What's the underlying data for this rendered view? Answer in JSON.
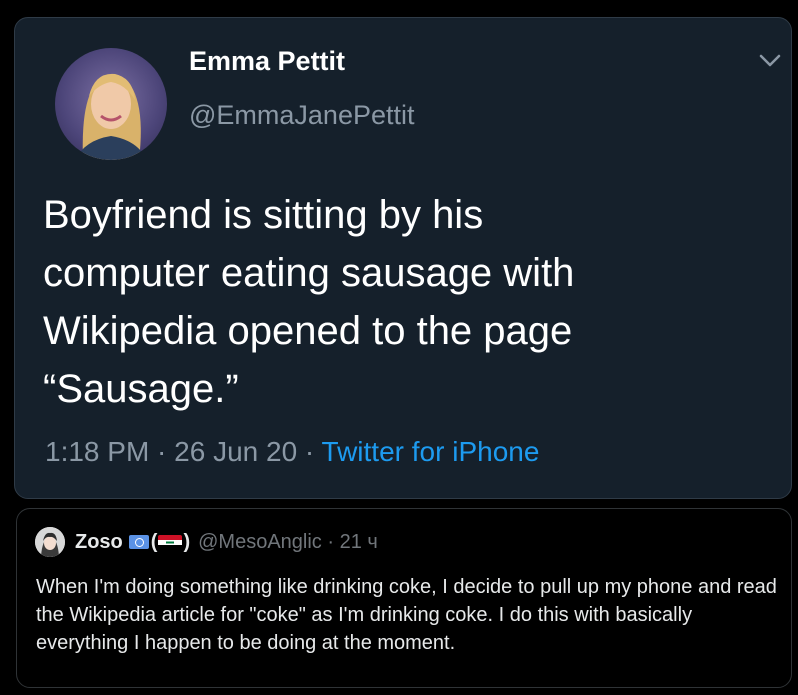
{
  "tweet": {
    "display_name": "Emma Pettit",
    "handle": "@EmmaJanePettit",
    "text": "Boyfriend is sitting by his\ncomputer eating sausage with\nWikipedia opened to the page\n“Sausage.”",
    "time": "1:18 PM · 26 Jun 20 · ",
    "source": "Twitter for iPhone"
  },
  "reply": {
    "display_name": "Zoso",
    "paren_open": "(",
    "paren_close": ")",
    "handle_time": "@MesoAnglic · 21 ч",
    "text": "When I'm doing something like drinking coke, I decide to pull up my phone and read the Wikipedia article for \"coke\" as I'm drinking coke. I do this with basically everything I happen to be doing at the moment."
  },
  "colors": {
    "tweet_bg": "#15202b",
    "link_blue": "#1d9bf0",
    "secondary_text": "#8b98a5"
  },
  "icons": [
    "avatar-photo",
    "chevron-down-icon",
    "un-flag-icon",
    "iraq-flag-icon"
  ]
}
